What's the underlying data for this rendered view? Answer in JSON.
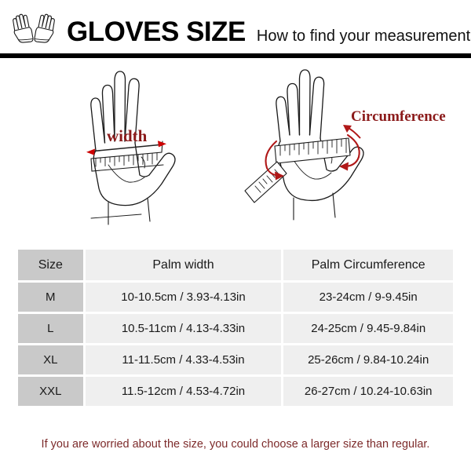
{
  "header": {
    "logo_icon": "gloves-pair-icon",
    "title": "GLOVES SIZE",
    "subtitle": "How to find your measurements"
  },
  "diagrams": [
    {
      "id": "palm-width",
      "label": "width",
      "label_color": "#8b1a1a",
      "arrow_color": "#cc0000",
      "icon": "hand-palm-with-ruler-icon",
      "description": "Open hand palm with ruler laid across the palm, double headed arrow labeled width"
    },
    {
      "id": "palm-circumference",
      "label": "Circumference",
      "label_color": "#8b1a1a",
      "arrow_color": "#b01818",
      "icon": "hand-palm-with-measuring-tape-icon",
      "description": "Open hand palm with measuring tape wrapped around the palm, curved arrows labeled Circumference"
    }
  ],
  "table": {
    "columns": [
      "Size",
      "Palm width",
      "Palm Circumference"
    ],
    "rows": [
      {
        "size": "M",
        "palm_width": "10-10.5cm / 3.93-4.13in",
        "palm_circumference": "23-24cm / 9-9.45in"
      },
      {
        "size": "L",
        "palm_width": "10.5-11cm / 4.13-4.33in",
        "palm_circumference": "24-25cm / 9.45-9.84in"
      },
      {
        "size": "XL",
        "palm_width": "11-11.5cm / 4.33-4.53in",
        "palm_circumference": "25-26cm / 9.84-10.24in"
      },
      {
        "size": "XXL",
        "palm_width": "11.5-12cm / 4.53-4.72in",
        "palm_circumference": "26-27cm / 10.24-10.63in"
      }
    ]
  },
  "footer": {
    "note": "If you are worried about the size, you could choose a larger size than regular."
  },
  "colors": {
    "accent_red": "#8b1a1a",
    "header_bar": "#000000",
    "size_cell_bg": "#c9c9c9",
    "data_cell_bg": "#efefef",
    "page_bg": "#ffffff"
  }
}
